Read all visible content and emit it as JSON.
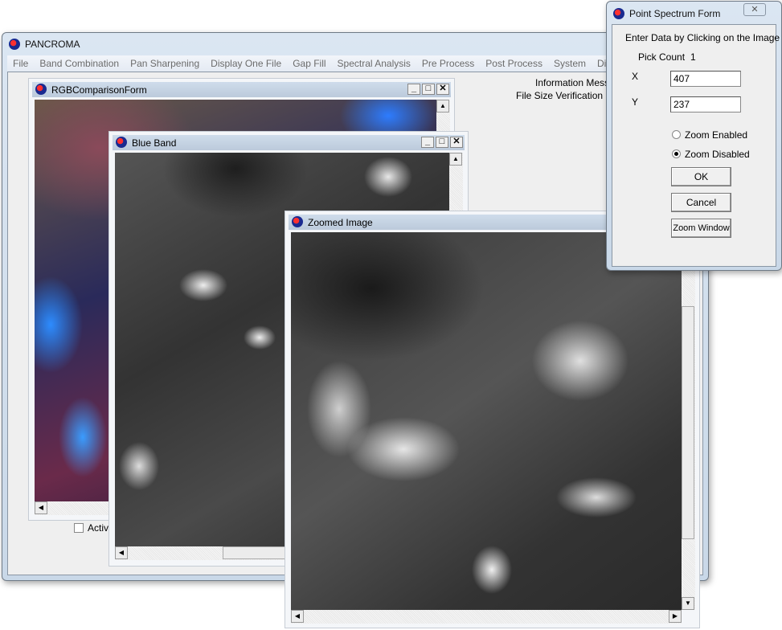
{
  "main_window": {
    "title": "PANCROMA",
    "menu": [
      "File",
      "Band Combination",
      "Pan Sharpening",
      "Display One File",
      "Gap Fill",
      "Spectral Analysis",
      "Pre Process",
      "Post Process",
      "System",
      "Display"
    ],
    "info_label": "Information  Messa",
    "verify_label": "File Size Verification Che",
    "checkbox_label": "Activa",
    "checkbox_checked": false
  },
  "rgb_form": {
    "title": "RGBComparisonForm"
  },
  "blue_band": {
    "title": "Blue Band"
  },
  "zoomed": {
    "title": "Zoomed Image"
  },
  "point_spectrum": {
    "title": "Point Spectrum Form",
    "close": "✕",
    "instruction": "Enter Data by Clicking on the Image",
    "pick_count_label": "Pick Count",
    "pick_count": "1",
    "x_label": "X",
    "x_value": "407",
    "y_label": "Y",
    "y_value": "237",
    "zoom_enabled": "Zoom Enabled",
    "zoom_disabled": "Zoom Disabled",
    "zoom_selected": "Zoom Disabled",
    "ok": "OK",
    "cancel": "Cancel",
    "window_button": "Zoom Window"
  },
  "window_controls": {
    "min": "_",
    "max": "□",
    "close": "✕"
  }
}
